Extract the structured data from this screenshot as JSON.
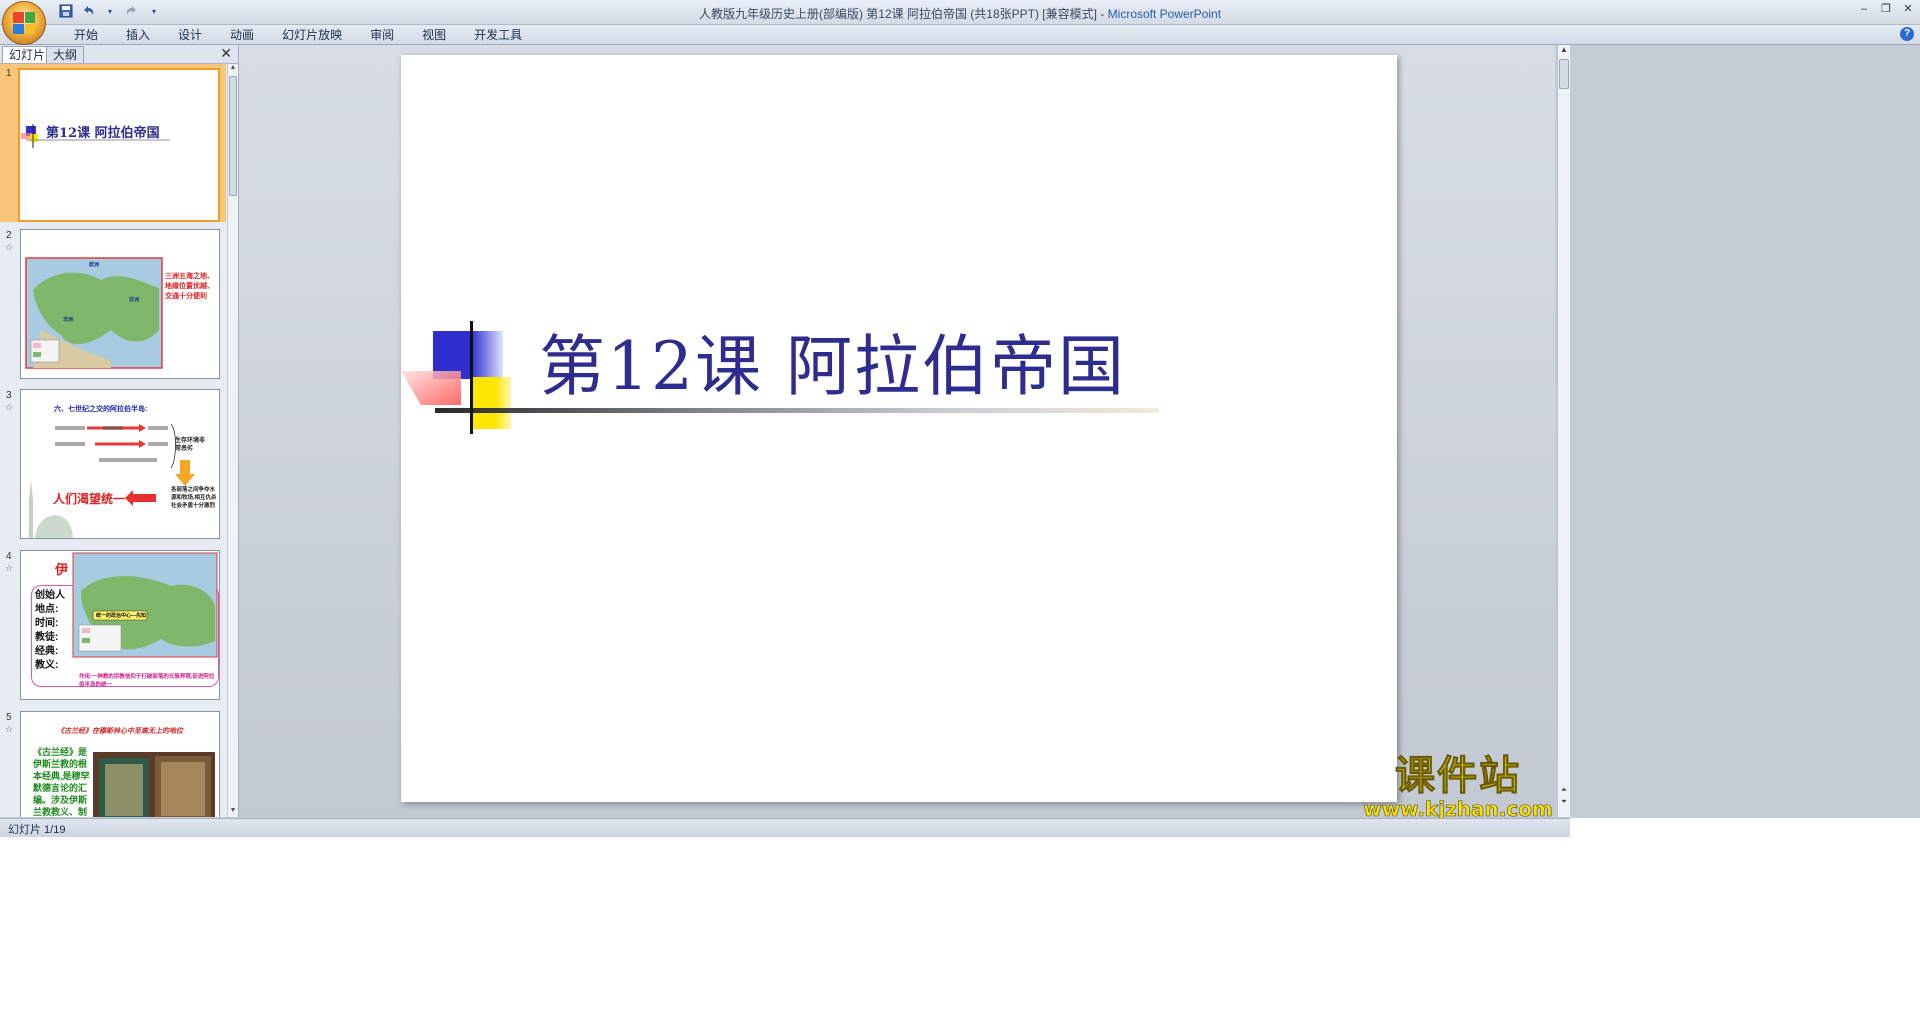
{
  "window": {
    "title": "人教版九年级历史上册(部编版) 第12课 阿拉伯帝国 (共18张PPT) [兼容模式] -",
    "app_name": "Microsoft PowerPoint"
  },
  "quick_access": {
    "save": "save-icon",
    "undo": "undo-icon",
    "redo": "redo-icon",
    "customize": "▾"
  },
  "ribbon_tabs": [
    "开始",
    "插入",
    "设计",
    "动画",
    "幻灯片放映",
    "审阅",
    "视图",
    "开发工具"
  ],
  "pane_tabs": {
    "slides": "幻灯片",
    "outline": "大纲"
  },
  "thumbnails": [
    {
      "num": "1",
      "title": "第12课 阿拉伯帝国"
    },
    {
      "num": "2",
      "text": "三洲五海之地、地缘位置优越、交通十分便利",
      "map_top": "欧洲",
      "map_right": "亚洲",
      "map_left": "非洲"
    },
    {
      "num": "3",
      "heading": "六、七世纪之交的阿拉伯半岛:",
      "callout": "人们渴望统一",
      "side1": "生存环境非常恶劣",
      "side2": "各部落之间争夺水源和牧场,相互仇杀社会矛盾十分激烈"
    },
    {
      "num": "4",
      "heading": "伊",
      "items": [
        "创始人",
        "地点:",
        "时间:",
        "教徒:",
        "经典:",
        "教义:"
      ],
      "label": "统一的政治中心—先知",
      "footer": "作用:一神教的宗教信仰于打破部落的氏族界限,促进阿拉伯半岛的统一"
    },
    {
      "num": "5",
      "heading": "《古兰经》在穆斯林心中至高无上的地位",
      "body": "《古兰经》是伊斯兰教的根本经典,是穆罕默德言论的汇编。涉及伊斯兰教教义、制度和法律"
    }
  ],
  "slide": {
    "title": "第12课 阿拉伯帝国"
  },
  "status": {
    "slide_counter": "幻灯片 1/19"
  },
  "watermark": {
    "cn": "课件站",
    "url": "www.kjzhan.com"
  },
  "colors": {
    "title": "#2e2c8f",
    "accent_blue": "#2f2fd0",
    "accent_yellow": "#ffe600",
    "accent_red": "#ff6a6a"
  }
}
